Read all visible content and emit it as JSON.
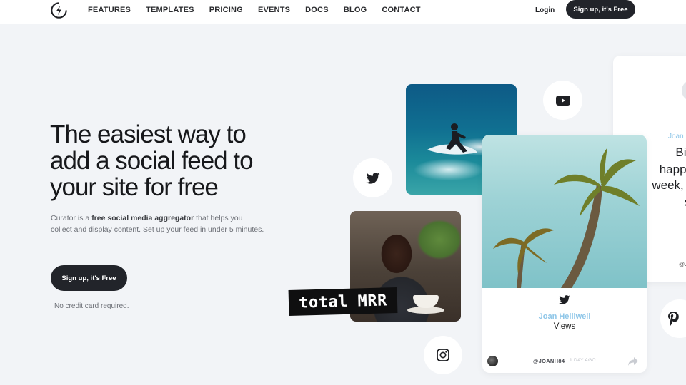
{
  "nav": {
    "items": [
      "FEATURES",
      "TEMPLATES",
      "PRICING",
      "EVENTS",
      "DOCS",
      "BLOG",
      "CONTACT"
    ],
    "login_label": "Login",
    "signup_label": "Sign up, it's Free"
  },
  "hero": {
    "headline": "The easiest way to add a social feed to your site for free",
    "sub_prefix": "Curator is a ",
    "sub_bold": "free social media aggregator",
    "sub_suffix": " that helps you collect and display content. Set up your feed in under 5 minutes.",
    "cta_label": "Sign up, it's Free",
    "note": "No credit card required."
  },
  "collage": {
    "overlay_text": "total MRR",
    "post": {
      "author": "Joan Helliwell",
      "text": "Views",
      "handle": "@JOANH84",
      "time": "1 DAY AGO"
    },
    "side_post": {
      "author": "Joan",
      "lines": [
        "Big",
        "happe",
        "week, c",
        "sl"
      ],
      "handle": "@J"
    },
    "icons": [
      "youtube-icon",
      "twitter-icon",
      "instagram-icon",
      "pinterest-icon"
    ]
  },
  "colors": {
    "accent_dark": "#22242a",
    "author_blue": "#8ec6e8",
    "background": "#f2f4f7"
  }
}
